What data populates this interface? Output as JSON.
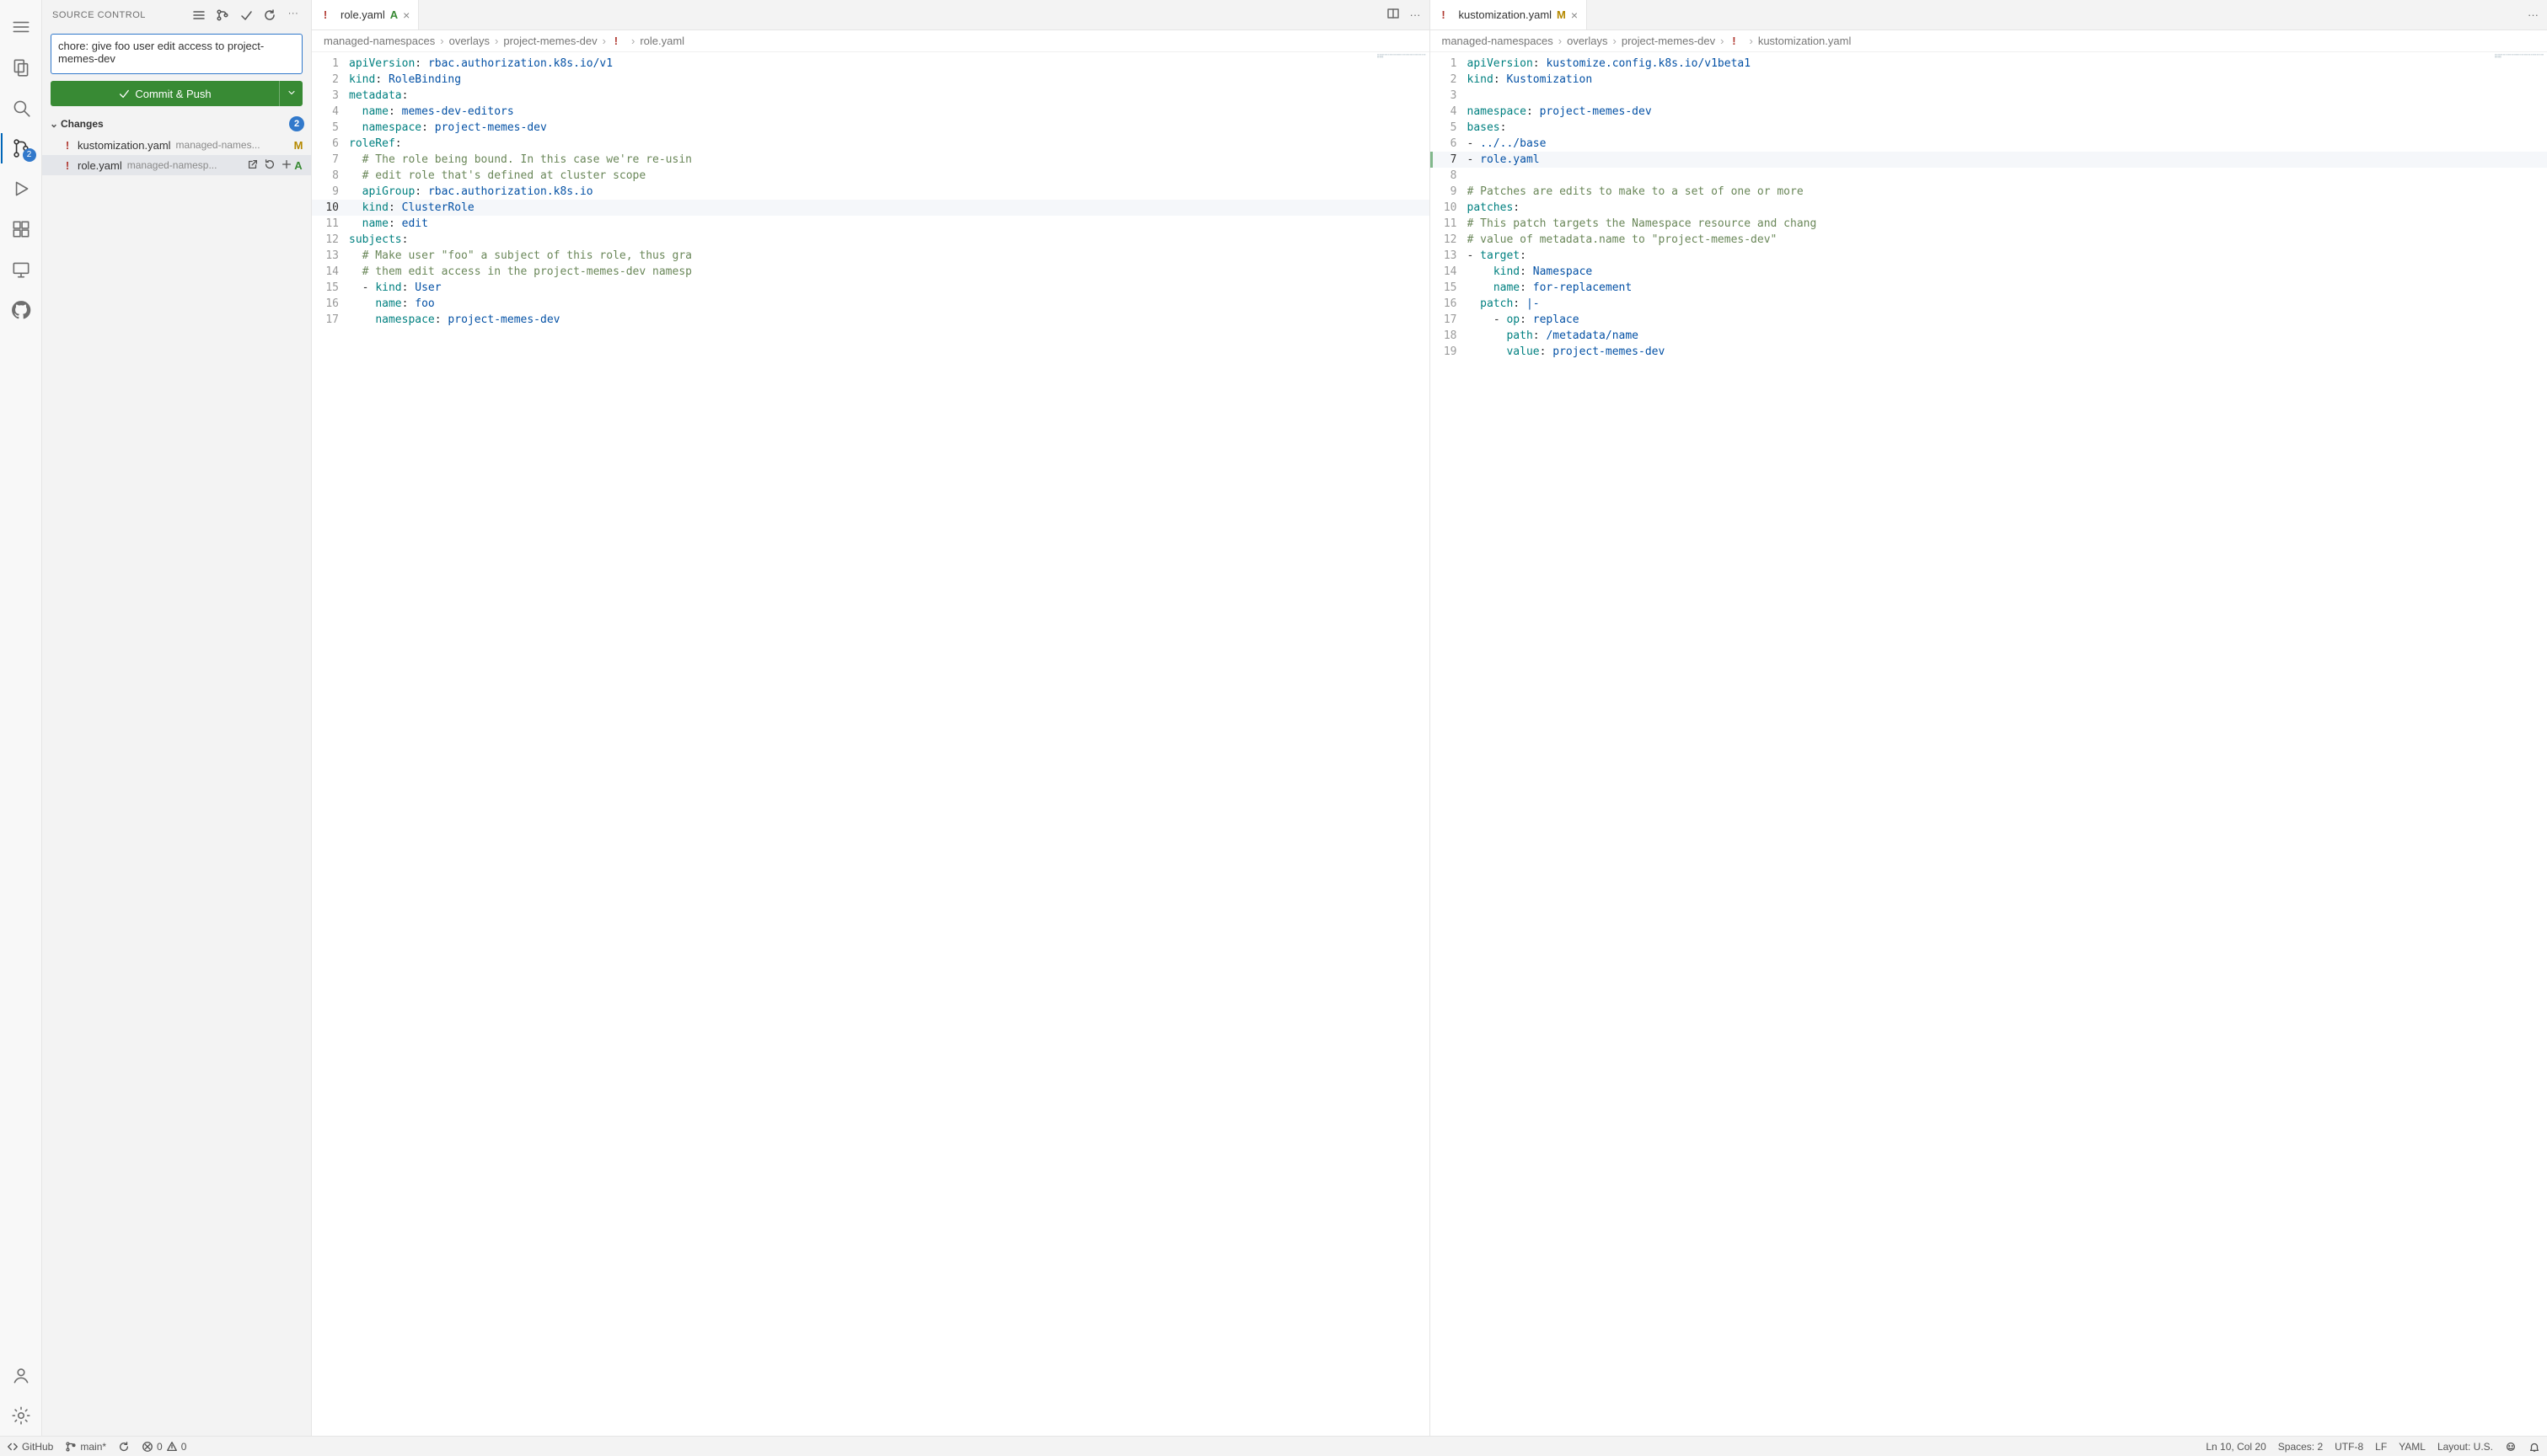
{
  "activity": {
    "scm_badge": "2"
  },
  "sidebar": {
    "title": "SOURCE CONTROL",
    "commit_message": "chore: give foo user edit access to project-memes-dev",
    "commit_button": "Commit & Push",
    "changes_label": "Changes",
    "changes_count": "2",
    "items": [
      {
        "icon": "!",
        "name": "kustomization.yaml",
        "path": "managed-names...",
        "status": "M"
      },
      {
        "icon": "!",
        "name": "role.yaml",
        "path": "managed-namesp...",
        "status": "A"
      }
    ]
  },
  "editors": [
    {
      "tab": {
        "icon": "!",
        "name": "role.yaml",
        "status": "A"
      },
      "breadcrumb": [
        "managed-namespaces",
        "overlays",
        "project-memes-dev",
        "!",
        "role.yaml"
      ],
      "active_line": 10,
      "code": [
        [
          {
            "t": "key",
            "v": "apiVersion"
          },
          {
            "t": "punc",
            "v": ": "
          },
          {
            "t": "str",
            "v": "rbac.authorization.k8s.io/v1"
          }
        ],
        [
          {
            "t": "key",
            "v": "kind"
          },
          {
            "t": "punc",
            "v": ": "
          },
          {
            "t": "str",
            "v": "RoleBinding"
          }
        ],
        [
          {
            "t": "key",
            "v": "metadata"
          },
          {
            "t": "punc",
            "v": ":"
          }
        ],
        [
          {
            "t": "ind",
            "v": "  "
          },
          {
            "t": "key",
            "v": "name"
          },
          {
            "t": "punc",
            "v": ": "
          },
          {
            "t": "str",
            "v": "memes-dev-editors"
          }
        ],
        [
          {
            "t": "ind",
            "v": "  "
          },
          {
            "t": "key",
            "v": "namespace"
          },
          {
            "t": "punc",
            "v": ": "
          },
          {
            "t": "str",
            "v": "project-memes-dev"
          }
        ],
        [
          {
            "t": "key",
            "v": "roleRef"
          },
          {
            "t": "punc",
            "v": ":"
          }
        ],
        [
          {
            "t": "ind",
            "v": "  "
          },
          {
            "t": "cmt",
            "v": "# The role being bound. In this case we're re-usin"
          }
        ],
        [
          {
            "t": "ind",
            "v": "  "
          },
          {
            "t": "cmt",
            "v": "# edit role that's defined at cluster scope"
          }
        ],
        [
          {
            "t": "ind",
            "v": "  "
          },
          {
            "t": "key",
            "v": "apiGroup"
          },
          {
            "t": "punc",
            "v": ": "
          },
          {
            "t": "str",
            "v": "rbac.authorization.k8s.io"
          }
        ],
        [
          {
            "t": "ind",
            "v": "  "
          },
          {
            "t": "key",
            "v": "kind"
          },
          {
            "t": "punc",
            "v": ": "
          },
          {
            "t": "str",
            "v": "ClusterRole"
          }
        ],
        [
          {
            "t": "ind",
            "v": "  "
          },
          {
            "t": "key",
            "v": "name"
          },
          {
            "t": "punc",
            "v": ": "
          },
          {
            "t": "str",
            "v": "edit"
          }
        ],
        [
          {
            "t": "key",
            "v": "subjects"
          },
          {
            "t": "punc",
            "v": ":"
          }
        ],
        [
          {
            "t": "ind",
            "v": "  "
          },
          {
            "t": "cmt",
            "v": "# Make user \"foo\" a subject of this role, thus gra"
          }
        ],
        [
          {
            "t": "ind",
            "v": "  "
          },
          {
            "t": "cmt",
            "v": "# them edit access in the project-memes-dev namesp"
          }
        ],
        [
          {
            "t": "ind",
            "v": "  "
          },
          {
            "t": "punc",
            "v": "- "
          },
          {
            "t": "key",
            "v": "kind"
          },
          {
            "t": "punc",
            "v": ": "
          },
          {
            "t": "str",
            "v": "User"
          }
        ],
        [
          {
            "t": "ind",
            "v": "    "
          },
          {
            "t": "key",
            "v": "name"
          },
          {
            "t": "punc",
            "v": ": "
          },
          {
            "t": "str",
            "v": "foo"
          }
        ],
        [
          {
            "t": "ind",
            "v": "    "
          },
          {
            "t": "key",
            "v": "namespace"
          },
          {
            "t": "punc",
            "v": ": "
          },
          {
            "t": "str",
            "v": "project-memes-dev"
          }
        ]
      ]
    },
    {
      "tab": {
        "icon": "!",
        "name": "kustomization.yaml",
        "status": "M"
      },
      "breadcrumb": [
        "managed-namespaces",
        "overlays",
        "project-memes-dev",
        "!",
        "kustomization.yaml"
      ],
      "active_line": 7,
      "added_lines": [
        7
      ],
      "code": [
        [
          {
            "t": "key",
            "v": "apiVersion"
          },
          {
            "t": "punc",
            "v": ": "
          },
          {
            "t": "str",
            "v": "kustomize.config.k8s.io/v1beta1"
          }
        ],
        [
          {
            "t": "key",
            "v": "kind"
          },
          {
            "t": "punc",
            "v": ": "
          },
          {
            "t": "str",
            "v": "Kustomization"
          }
        ],
        [],
        [
          {
            "t": "key",
            "v": "namespace"
          },
          {
            "t": "punc",
            "v": ": "
          },
          {
            "t": "str",
            "v": "project-memes-dev"
          }
        ],
        [
          {
            "t": "key",
            "v": "bases"
          },
          {
            "t": "punc",
            "v": ":"
          }
        ],
        [
          {
            "t": "punc",
            "v": "- "
          },
          {
            "t": "str",
            "v": "../../base"
          }
        ],
        [
          {
            "t": "punc",
            "v": "- "
          },
          {
            "t": "str",
            "v": "role.yaml"
          }
        ],
        [],
        [
          {
            "t": "cmt",
            "v": "# Patches are edits to make to a set of one or more "
          }
        ],
        [
          {
            "t": "key",
            "v": "patches"
          },
          {
            "t": "punc",
            "v": ":"
          }
        ],
        [
          {
            "t": "cmt",
            "v": "# This patch targets the Namespace resource and chang"
          }
        ],
        [
          {
            "t": "cmt",
            "v": "# value of metadata.name to \"project-memes-dev\""
          }
        ],
        [
          {
            "t": "punc",
            "v": "- "
          },
          {
            "t": "key",
            "v": "target"
          },
          {
            "t": "punc",
            "v": ":"
          }
        ],
        [
          {
            "t": "ind",
            "v": "    "
          },
          {
            "t": "key",
            "v": "kind"
          },
          {
            "t": "punc",
            "v": ": "
          },
          {
            "t": "str",
            "v": "Namespace"
          }
        ],
        [
          {
            "t": "ind",
            "v": "    "
          },
          {
            "t": "key",
            "v": "name"
          },
          {
            "t": "punc",
            "v": ": "
          },
          {
            "t": "str",
            "v": "for-replacement"
          }
        ],
        [
          {
            "t": "ind",
            "v": "  "
          },
          {
            "t": "key",
            "v": "patch"
          },
          {
            "t": "punc",
            "v": ": "
          },
          {
            "t": "str",
            "v": "|-"
          }
        ],
        [
          {
            "t": "ind",
            "v": "    "
          },
          {
            "t": "punc",
            "v": "- "
          },
          {
            "t": "key",
            "v": "op"
          },
          {
            "t": "punc",
            "v": ": "
          },
          {
            "t": "str",
            "v": "replace"
          }
        ],
        [
          {
            "t": "ind",
            "v": "      "
          },
          {
            "t": "key",
            "v": "path"
          },
          {
            "t": "punc",
            "v": ": "
          },
          {
            "t": "str",
            "v": "/metadata/name"
          }
        ],
        [
          {
            "t": "ind",
            "v": "      "
          },
          {
            "t": "key",
            "v": "value"
          },
          {
            "t": "punc",
            "v": ": "
          },
          {
            "t": "str",
            "v": "project-memes-dev"
          }
        ]
      ]
    }
  ],
  "statusbar": {
    "left": {
      "github": "GitHub",
      "branch": "main*",
      "errors": "0",
      "warnings": "0"
    },
    "right": {
      "cursor": "Ln 10, Col 20",
      "spaces": "Spaces: 2",
      "encoding": "UTF-8",
      "eol": "LF",
      "lang": "YAML",
      "layout": "Layout: U.S."
    }
  }
}
